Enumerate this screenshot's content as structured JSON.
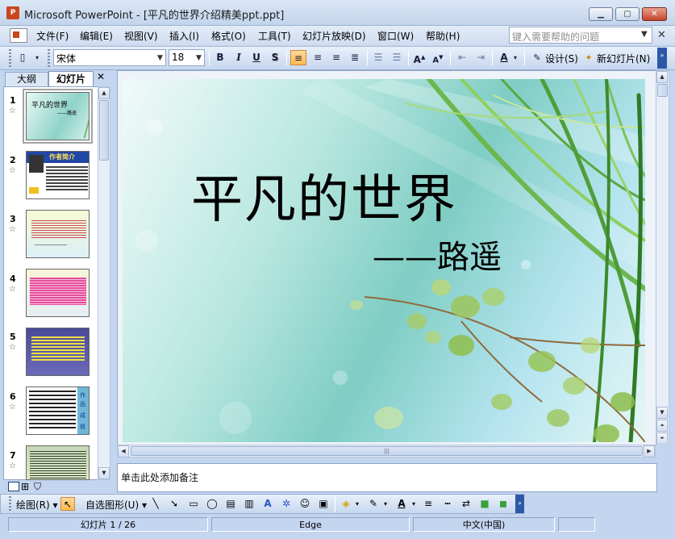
{
  "window": {
    "title": "Microsoft PowerPoint - [平凡的世界介绍精美ppt.ppt]",
    "app_icon_label": "P"
  },
  "menu": {
    "items": [
      "文件(F)",
      "编辑(E)",
      "视图(V)",
      "插入(I)",
      "格式(O)",
      "工具(T)",
      "幻灯片放映(D)",
      "窗口(W)",
      "帮助(H)"
    ],
    "help_placeholder": "键入需要帮助的问题"
  },
  "toolbar": {
    "font": "宋体",
    "size": "18",
    "bold": "B",
    "italic": "I",
    "underline": "U",
    "shadow": "S",
    "font_color": "A",
    "design_label": "设计(S)",
    "new_slide_label": "新幻灯片(N)"
  },
  "pane": {
    "tabs": [
      "大纲",
      "幻灯片"
    ],
    "close": "✕",
    "slide_numbers": [
      "1",
      "2",
      "3",
      "4",
      "5",
      "6",
      "7"
    ],
    "thumb1_title": "平凡的世界",
    "thumb1_sub": "——路遥",
    "thumb2_title": "作者简介",
    "thumb6_side": [
      "作",
      "品",
      "成",
      "就"
    ]
  },
  "slide": {
    "title": "平凡的世界",
    "subtitle": "——路遥"
  },
  "notes": {
    "placeholder": "单击此处添加备注"
  },
  "drawing": {
    "draw_label": "绘图(R)",
    "autoshape_label": "自选图形(U)"
  },
  "status": {
    "slide_counter": "幻灯片 1 / 26",
    "design": "Edge",
    "language": "中文(中国)"
  },
  "colors": {
    "accent": "#ffb94e",
    "chrome": "#c3d5ef",
    "titlebar": "#dbe7f6"
  }
}
